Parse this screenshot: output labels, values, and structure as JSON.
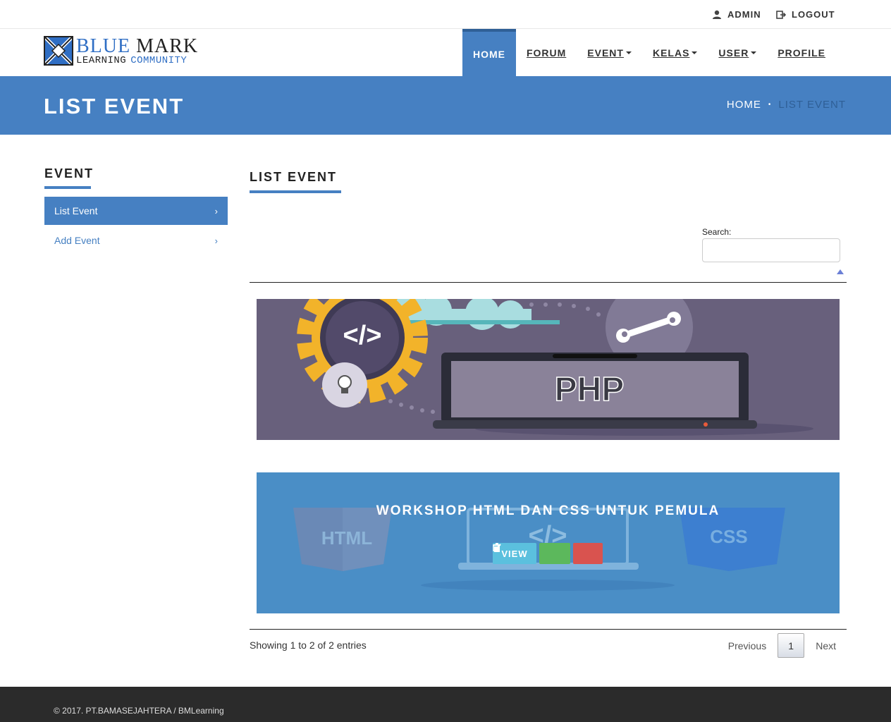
{
  "topbar": {
    "admin_label": "ADMIN",
    "logout_label": "LOGOUT"
  },
  "logo": {
    "line1_blue": "BLUE",
    "line1_black": "MARK",
    "line2_black": "LEARNING",
    "line2_blue": "COMMUNITY"
  },
  "nav": {
    "items": [
      {
        "label": "HOME"
      },
      {
        "label": "FORUM"
      },
      {
        "label": "EVENT"
      },
      {
        "label": "KELAS"
      },
      {
        "label": "USER"
      },
      {
        "label": "PROFILE"
      }
    ]
  },
  "banner": {
    "title": "LIST EVENT",
    "breadcrumb_home": "HOME",
    "breadcrumb_sep": "•",
    "breadcrumb_current": "LIST EVENT"
  },
  "sidebar": {
    "title": "EVENT",
    "items": [
      {
        "label": "List Event",
        "chevron": "›"
      },
      {
        "label": "Add Event",
        "chevron": "›"
      }
    ]
  },
  "main": {
    "title": "LIST EVENT",
    "search_label": "Search:",
    "search_value": "",
    "events": [
      {
        "image_text": "PHP"
      },
      {
        "image_text_left": "HTML",
        "image_text_right": "CSS",
        "title": "WORKSHOP HTML DAN CSS UNTUK PEMULA",
        "view_label": "VIEW"
      }
    ],
    "info": "Showing 1 to 2 of 2 entries",
    "pagination": {
      "previous": "Previous",
      "current": "1",
      "next": "Next"
    }
  },
  "footer": {
    "text": "© 2017. PT.BAMASEJAHTERA / BMLearning"
  },
  "colors": {
    "primary": "#4680c2",
    "view": "#5bc0de",
    "edit": "#5cb85c",
    "delete": "#d9534f",
    "footer": "#2b2b2b"
  }
}
